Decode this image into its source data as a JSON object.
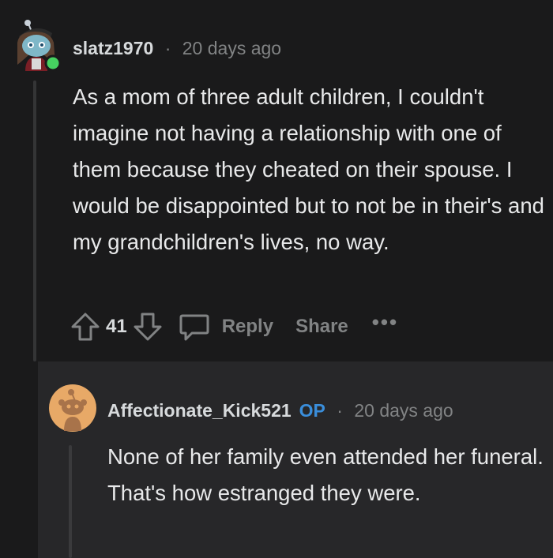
{
  "comment": {
    "username": "slatz1970",
    "separator": "·",
    "timestamp": "20 days ago",
    "body": "As a mom of three adult children, I couldn't imagine not having a relationship with one of them because they cheated on their spouse. I would be disappointed but to not be in their's and my grandchildren's lives, no way.",
    "vote_count": "41",
    "reply_label": "Reply",
    "share_label": "Share",
    "more_label": "•••",
    "online_status_color": "#46d160"
  },
  "reply": {
    "username": "Affectionate_Kick521",
    "op_badge": "OP",
    "separator": "·",
    "timestamp": "20 days ago",
    "body": "None of her family even attended her funeral. That's how estranged they were."
  },
  "colors": {
    "background": "#1a1a1b",
    "reply_background": "#272729",
    "text_primary": "#e8e9ea",
    "text_muted": "#818384",
    "op_blue": "#3a8edb",
    "avatar_orange": "#e8a967"
  },
  "icons": [
    "upvote-icon",
    "downvote-icon",
    "reply-bubble-icon",
    "more-options-icon"
  ]
}
